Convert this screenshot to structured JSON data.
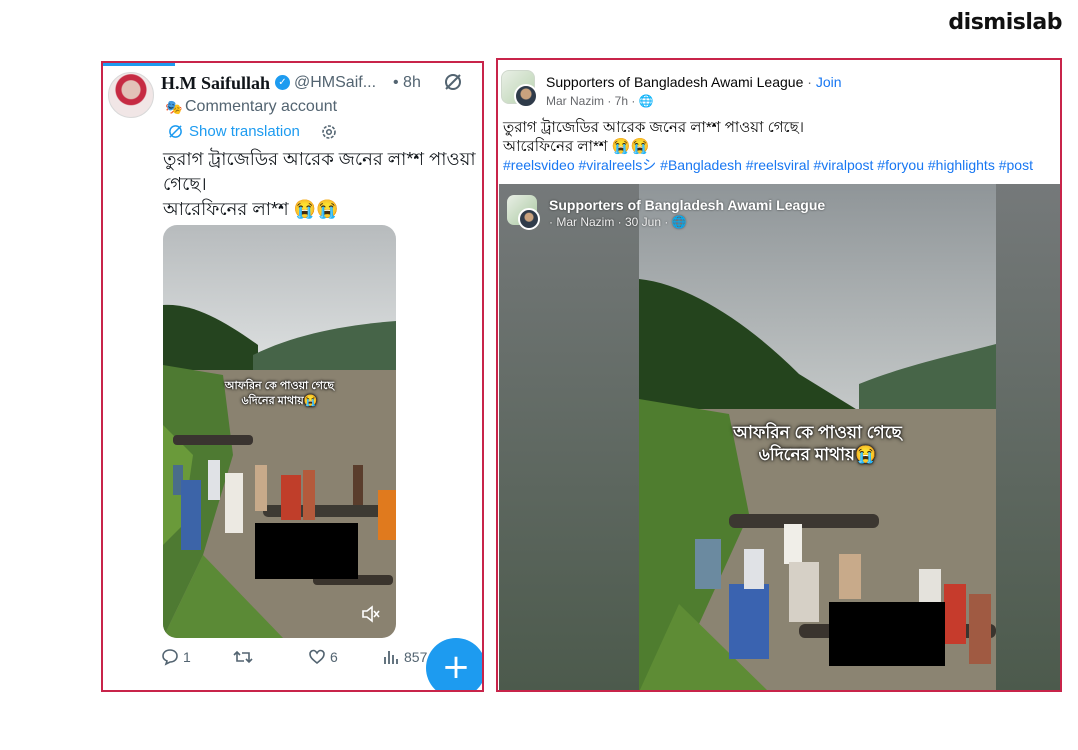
{
  "brand": "dismislab",
  "x_post": {
    "name": "H.M Saifullah",
    "handle": "@HMSaif...",
    "time": "• 8h",
    "account_label": "Commentary account",
    "translate_label": "Show translation",
    "text_lines": [
      "তুরাগ ট্রাজেডির আরেক জনের লা*শ পাওয়া",
      "গেছে।",
      "আরেফিনের লা*শ 😭😭"
    ],
    "video_overlay_line1": "আফরিন কে পাওয়া গেছে",
    "video_overlay_line2": "৬দিনের মাথায়😭",
    "actions": {
      "replies": "1",
      "likes": "6",
      "views": "857"
    },
    "icons": [
      "verified-badge-icon",
      "grok-icon",
      "commentary-mask-icon",
      "translate-icon",
      "gear-icon",
      "mute-icon",
      "reply-icon",
      "retweet-icon",
      "like-icon",
      "views-icon",
      "compose-icon"
    ],
    "colors": {
      "accent": "#1d9bf0",
      "text": "#0f1419",
      "muted": "#536471"
    }
  },
  "fb_post": {
    "group_name": "Supporters of Bangladesh Awami League",
    "separator": " · ",
    "join_label": "Join",
    "author_meta": "Mar Nazim · 7h · 🌐",
    "text_lines": [
      "তুরাগ ট্রাজেডির আরেক জনের লা*শ পাওয়া গেছে।",
      "আরেফিনের লা*শ 😭😭"
    ],
    "hashtags": "#reelsvideo #viralreelsシ #Bangladesh #reelsviral #viralpost #foryou #highlights #post",
    "media": {
      "group_name": "Supporters of Bangladesh Awami League",
      "author_meta": "· Mar Nazim · 30 Jun · 🌐",
      "overlay_line1": "আফরিন কে পাওয়া গেছে",
      "overlay_line2": "৬দিনের মাথায়😭"
    },
    "colors": {
      "accent": "#1877f2",
      "text": "#050505",
      "muted": "#65676b"
    }
  },
  "highlight_border_color": "#c8244a"
}
